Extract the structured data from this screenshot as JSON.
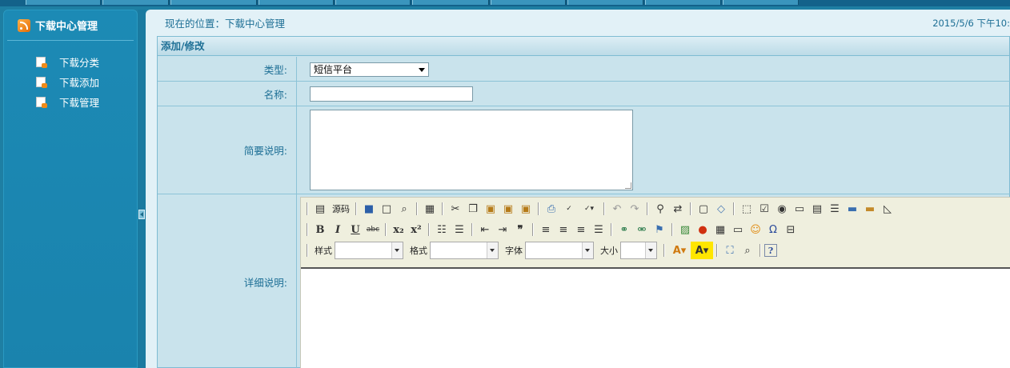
{
  "sidebar": {
    "title": "下载中心管理",
    "items": [
      {
        "label": "下载分类"
      },
      {
        "label": "下载添加"
      },
      {
        "label": "下载管理"
      }
    ]
  },
  "breadcrumb": {
    "text": "现在的位置：下载中心管理"
  },
  "datetime": "2015/5/6 下午10:",
  "panel": {
    "title": "添加/修改"
  },
  "form": {
    "type_label": "类型:",
    "type_value": "短信平台",
    "name_label": "名称:",
    "name_value": "",
    "summary_label": "简要说明:",
    "summary_value": "",
    "detail_label": "详细说明:"
  },
  "editor": {
    "source_label": "源码",
    "style_label": "样式",
    "format_label": "格式",
    "font_label": "字体",
    "size_label": "大小"
  },
  "colors": {
    "sidebar_bg": "#1c8ab5",
    "page_bg": "#e2f1f7",
    "label_text": "#1d6f95"
  }
}
